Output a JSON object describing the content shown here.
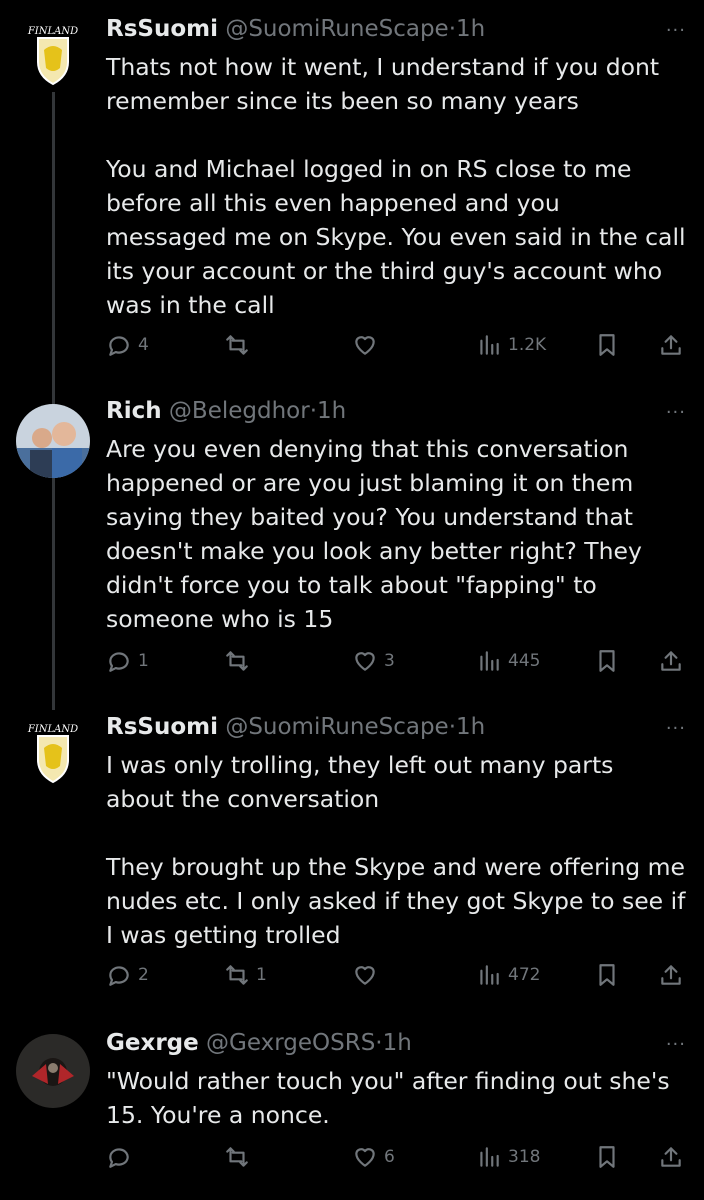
{
  "tweets": [
    {
      "name": "RsSuomi",
      "handle": "@SuomiRuneScape",
      "time": "1h",
      "avatar_label": "FINLAND",
      "paragraphs": [
        "Thats not how it went, I understand if you dont remember since its been so many years",
        "You and Michael logged in on RS close to me before all this even happened and you messaged me on Skype. You even said in the call its your account or the third guy's account who was in the call"
      ],
      "replies": "4",
      "reposts": "",
      "likes": "",
      "views": "1.2K"
    },
    {
      "name": "Rich",
      "handle": "@Belegdhor",
      "time": "1h",
      "paragraphs": [
        "Are you even denying that this conversation happened or are you just blaming it on them saying they baited you? You understand that doesn't make you look any better right? They didn't force you to talk about \"fapping\" to someone who is 15"
      ],
      "replies": "1",
      "reposts": "",
      "likes": "3",
      "views": "445"
    },
    {
      "name": "RsSuomi",
      "handle": "@SuomiRuneScape",
      "time": "1h",
      "avatar_label": "FINLAND",
      "paragraphs": [
        "I was only trolling, they left out many parts about the conversation",
        "They brought up the Skype and were offering me nudes etc. I only asked if they got Skype to see if I was getting trolled"
      ],
      "replies": "2",
      "reposts": "1",
      "likes": "",
      "views": "472"
    },
    {
      "name": "Gexrge",
      "handle": "@GexrgeOSRS",
      "time": "1h",
      "paragraphs": [
        "\"Would rather touch you\" after finding out she's 15. You're a nonce."
      ],
      "replies": "",
      "reposts": "",
      "likes": "6",
      "views": "318"
    }
  ],
  "separator": "·",
  "more_label": "···",
  "colors": {
    "background": "#000000",
    "text": "#e7e9ea",
    "muted": "#71767b",
    "thread_line": "#333639"
  },
  "icons": [
    "reply-icon",
    "repost-icon",
    "like-icon",
    "views-icon",
    "bookmark-icon",
    "share-icon",
    "more-icon"
  ]
}
